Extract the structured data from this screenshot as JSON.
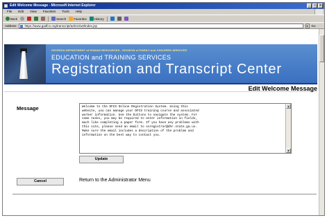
{
  "window": {
    "title": "Edit Welcome Message - Microsoft Internet Explorer",
    "controls": [
      "_",
      "□",
      "×"
    ]
  },
  "menu": [
    "File",
    "Edit",
    "View",
    "Favorites",
    "Tools",
    "Help"
  ],
  "toolbar": {
    "back": "Back",
    "search": "Search",
    "favorites": "Favorites",
    "history": "History"
  },
  "address": {
    "label": "Address",
    "url": "https://www.gadfcs.org/transcript/admin/welIndex.jsp",
    "go": "Go"
  },
  "banner": {
    "department": "GEORGIA DEPARTMENT of HUMAN RESOURCES - DIVISION of FAMILY and CHILDREN SERVICES",
    "subtitle": "EDUCATION and TRAINING SERVICES",
    "title": "Registration and Transcript Center"
  },
  "section": {
    "title": "Edit Welcome Message"
  },
  "form": {
    "message_label": "Message",
    "message_text": "Welcome to the DFCS Online Registration System. Using this\nwebsite, you can manage your DFCS training course and associated\nworker information. Use the buttons to navigate the system. For\nsome tasks, you may be required to enter information in fields,\nmuch like completing a paper form. If you have any problems with\nthis site, please send an email to ssregistrar@dhr.state.ga.us.\nMake sure the email includes a description of the problem and\ninformation on the best way to contact you.",
    "update_label": "Update",
    "cancel_label": "Cancel",
    "return_text": "Return to the Administrator Menu"
  }
}
